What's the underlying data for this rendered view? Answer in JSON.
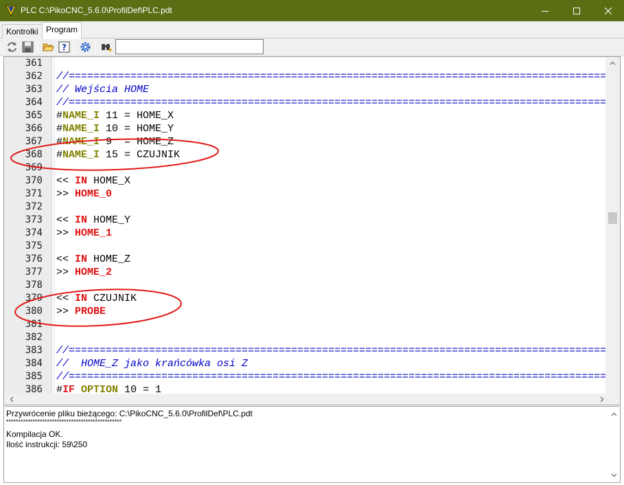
{
  "window": {
    "title": "PLC C:\\PikoCNC_5.6.0\\ProfilDef\\PLC.pdt",
    "icon": "app-logo-icon"
  },
  "tabs": [
    {
      "label": "Kontrolki",
      "active": false
    },
    {
      "label": "Program",
      "active": true
    }
  ],
  "toolbar": {
    "search_value": "",
    "buttons": [
      "refresh-icon",
      "save-icon",
      "open-folder-icon",
      "help-icon",
      "settings-gear-icon",
      "binoculars-find-icon"
    ]
  },
  "editor": {
    "rows": [
      {
        "n": "361",
        "tokens": []
      },
      {
        "n": "362",
        "tokens": [
          {
            "t": "//=======================================================================================",
            "c": "comment"
          }
        ]
      },
      {
        "n": "363",
        "tokens": [
          {
            "t": "// Wejścia HOME",
            "c": "comment"
          }
        ]
      },
      {
        "n": "364",
        "tokens": [
          {
            "t": "//=======================================================================================",
            "c": "comment"
          }
        ]
      },
      {
        "n": "365",
        "tokens": [
          {
            "t": "#",
            "c": ""
          },
          {
            "t": "NAME_I",
            "c": "kw"
          },
          {
            "t": " 11 = HOME_X",
            "c": ""
          }
        ]
      },
      {
        "n": "366",
        "tokens": [
          {
            "t": "#",
            "c": ""
          },
          {
            "t": "NAME_I",
            "c": "kw"
          },
          {
            "t": " 10 = HOME_Y",
            "c": ""
          }
        ]
      },
      {
        "n": "367",
        "tokens": [
          {
            "t": "#",
            "c": ""
          },
          {
            "t": "NAME_I",
            "c": "kw"
          },
          {
            "t": " 9  = HOME_Z",
            "c": ""
          }
        ]
      },
      {
        "n": "368",
        "tokens": [
          {
            "t": "#",
            "c": ""
          },
          {
            "t": "NAME_I",
            "c": "kw"
          },
          {
            "t": " 15 = CZUJNIK",
            "c": ""
          }
        ]
      },
      {
        "n": "369",
        "tokens": []
      },
      {
        "n": "370",
        "tokens": [
          {
            "t": "<< ",
            "c": ""
          },
          {
            "t": "IN",
            "c": "red"
          },
          {
            "t": " HOME_X",
            "c": ""
          }
        ]
      },
      {
        "n": "371",
        "tokens": [
          {
            "t": ">> ",
            "c": ""
          },
          {
            "t": "HOME_0",
            "c": "red"
          }
        ]
      },
      {
        "n": "372",
        "tokens": []
      },
      {
        "n": "373",
        "tokens": [
          {
            "t": "<< ",
            "c": ""
          },
          {
            "t": "IN",
            "c": "red"
          },
          {
            "t": " HOME_Y",
            "c": ""
          }
        ]
      },
      {
        "n": "374",
        "tokens": [
          {
            "t": ">> ",
            "c": ""
          },
          {
            "t": "HOME_1",
            "c": "red"
          }
        ]
      },
      {
        "n": "375",
        "tokens": []
      },
      {
        "n": "376",
        "tokens": [
          {
            "t": "<< ",
            "c": ""
          },
          {
            "t": "IN",
            "c": "red"
          },
          {
            "t": " HOME_Z",
            "c": ""
          }
        ]
      },
      {
        "n": "377",
        "tokens": [
          {
            "t": ">> ",
            "c": ""
          },
          {
            "t": "HOME_2",
            "c": "red"
          }
        ]
      },
      {
        "n": "378",
        "tokens": []
      },
      {
        "n": "379",
        "tokens": [
          {
            "t": "<< ",
            "c": ""
          },
          {
            "t": "IN",
            "c": "red"
          },
          {
            "t": " CZUJNIK",
            "c": ""
          }
        ]
      },
      {
        "n": "380",
        "tokens": [
          {
            "t": ">> ",
            "c": ""
          },
          {
            "t": "PROBE",
            "c": "red"
          }
        ]
      },
      {
        "n": "381",
        "tokens": []
      },
      {
        "n": "382",
        "tokens": []
      },
      {
        "n": "383",
        "tokens": [
          {
            "t": "//=======================================================================================",
            "c": "comment"
          }
        ]
      },
      {
        "n": "384",
        "tokens": [
          {
            "t": "//  HOME_Z jako krańcówka osi Z",
            "c": "comment"
          }
        ]
      },
      {
        "n": "385",
        "tokens": [
          {
            "t": "//=======================================================================================",
            "c": "comment"
          }
        ]
      },
      {
        "n": "386",
        "tokens": [
          {
            "t": "#",
            "c": ""
          },
          {
            "t": "IF",
            "c": "red"
          },
          {
            "t": " ",
            "c": ""
          },
          {
            "t": "OPTION",
            "c": "kw"
          },
          {
            "t": " 10 = 1",
            "c": ""
          }
        ]
      }
    ]
  },
  "output": {
    "lines": [
      "Przywrócenie pliku bieżącego: C:\\PikoCNC_5.6.0\\ProfilDef\\PLC.pdt",
      "************************************************",
      "Kompilacja OK.",
      "Ilość instrukcji: 59\\250"
    ]
  },
  "colors": {
    "titlebar": "#5a6e14",
    "comment": "#0000c8",
    "keyword": "#828200",
    "directive": "#e01010",
    "annotation": "#e01818"
  }
}
